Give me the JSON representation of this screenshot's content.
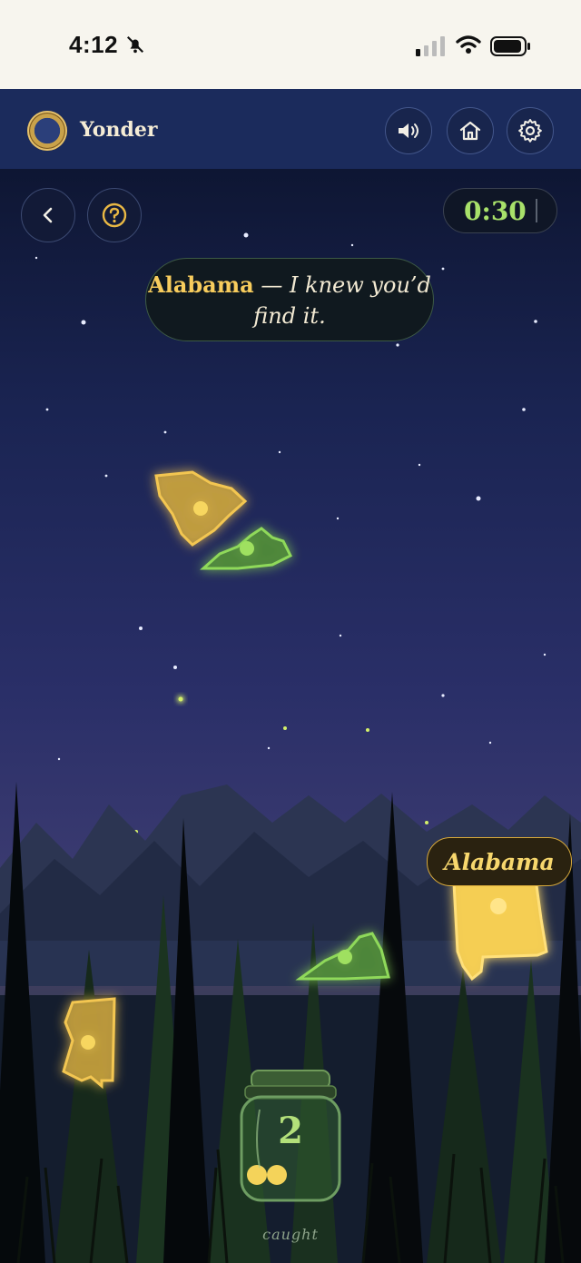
{
  "status": {
    "time": "4:12"
  },
  "header": {
    "title": "Yonder"
  },
  "game": {
    "timer": "0:30",
    "message_state": "Alabama",
    "message_text": " — I knew you’d find it.",
    "found_label": "Alabama",
    "jar_count": "2",
    "jar_caption": "caught",
    "states_on_screen": [
      "South Carolina",
      "Kentucky",
      "Virginia",
      "Mississippi",
      "Alabama"
    ]
  },
  "colors": {
    "gold": "#f7cc5d",
    "green": "#a8e16a",
    "sky_top": "#0e1633",
    "header_bg": "#1b2b5c"
  }
}
